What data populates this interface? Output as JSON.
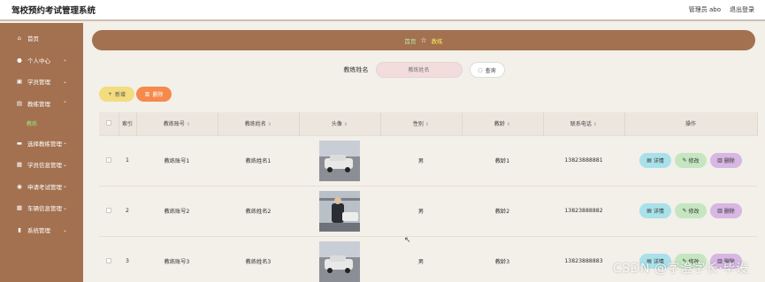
{
  "app": {
    "title": "驾校预约考试管理系统"
  },
  "header": {
    "admin_label": "管理员 abo",
    "logout_label": "退出登录"
  },
  "sidebar": {
    "items": [
      {
        "label": "首页",
        "icon": "home-icon",
        "expandable": false
      },
      {
        "label": "个人中心",
        "icon": "user-icon",
        "expandable": true
      },
      {
        "label": "学员管理",
        "icon": "student-icon",
        "expandable": true
      },
      {
        "label": "教练管理",
        "icon": "coach-icon",
        "expandable": true
      },
      {
        "label": "选择教练管理",
        "icon": "chat-icon",
        "expandable": true
      },
      {
        "label": "学员信息管理",
        "icon": "grid-icon",
        "expandable": true
      },
      {
        "label": "申请考试管理",
        "icon": "exam-icon",
        "expandable": true
      },
      {
        "label": "车辆信息管理",
        "icon": "grid-icon",
        "expandable": true
      },
      {
        "label": "系统管理",
        "icon": "chart-icon",
        "expandable": true
      }
    ],
    "active_sub": "教练"
  },
  "breadcrumb": {
    "home": "首页",
    "current": "教练"
  },
  "search": {
    "label": "教练姓名",
    "placeholder": "教练姓名",
    "button": "查询"
  },
  "actions": {
    "add": "新增",
    "delete": "删除"
  },
  "table": {
    "columns": [
      "索引",
      "教练账号",
      "教练姓名",
      "头像",
      "性别",
      "教龄",
      "联系电话",
      "操作"
    ],
    "rows": [
      {
        "index": "1",
        "account": "教练账号1",
        "name": "教练姓名1",
        "gender": "男",
        "age": "教龄1",
        "phone": "13823888881"
      },
      {
        "index": "2",
        "account": "教练账号2",
        "name": "教练姓名2",
        "gender": "男",
        "age": "教龄2",
        "phone": "13823888882"
      },
      {
        "index": "3",
        "account": "教练账号3",
        "name": "教练姓名3",
        "gender": "男",
        "age": "教龄3",
        "phone": "13823888883"
      }
    ],
    "row_actions": {
      "detail": "详情",
      "edit": "修改",
      "delete": "删除"
    }
  },
  "watermark": "CSDN @字澄字长·毕设",
  "colors": {
    "sidebar": "#a37150",
    "breadcrumb_bg": "#a37150",
    "page_bg": "#f3efe9",
    "add_btn": "#f3dc7e",
    "delete_btn": "#f58a4c",
    "detail_btn": "#a9e1ea",
    "edit_btn": "#c5e6c0",
    "row_delete_btn": "#d7b7e3"
  }
}
